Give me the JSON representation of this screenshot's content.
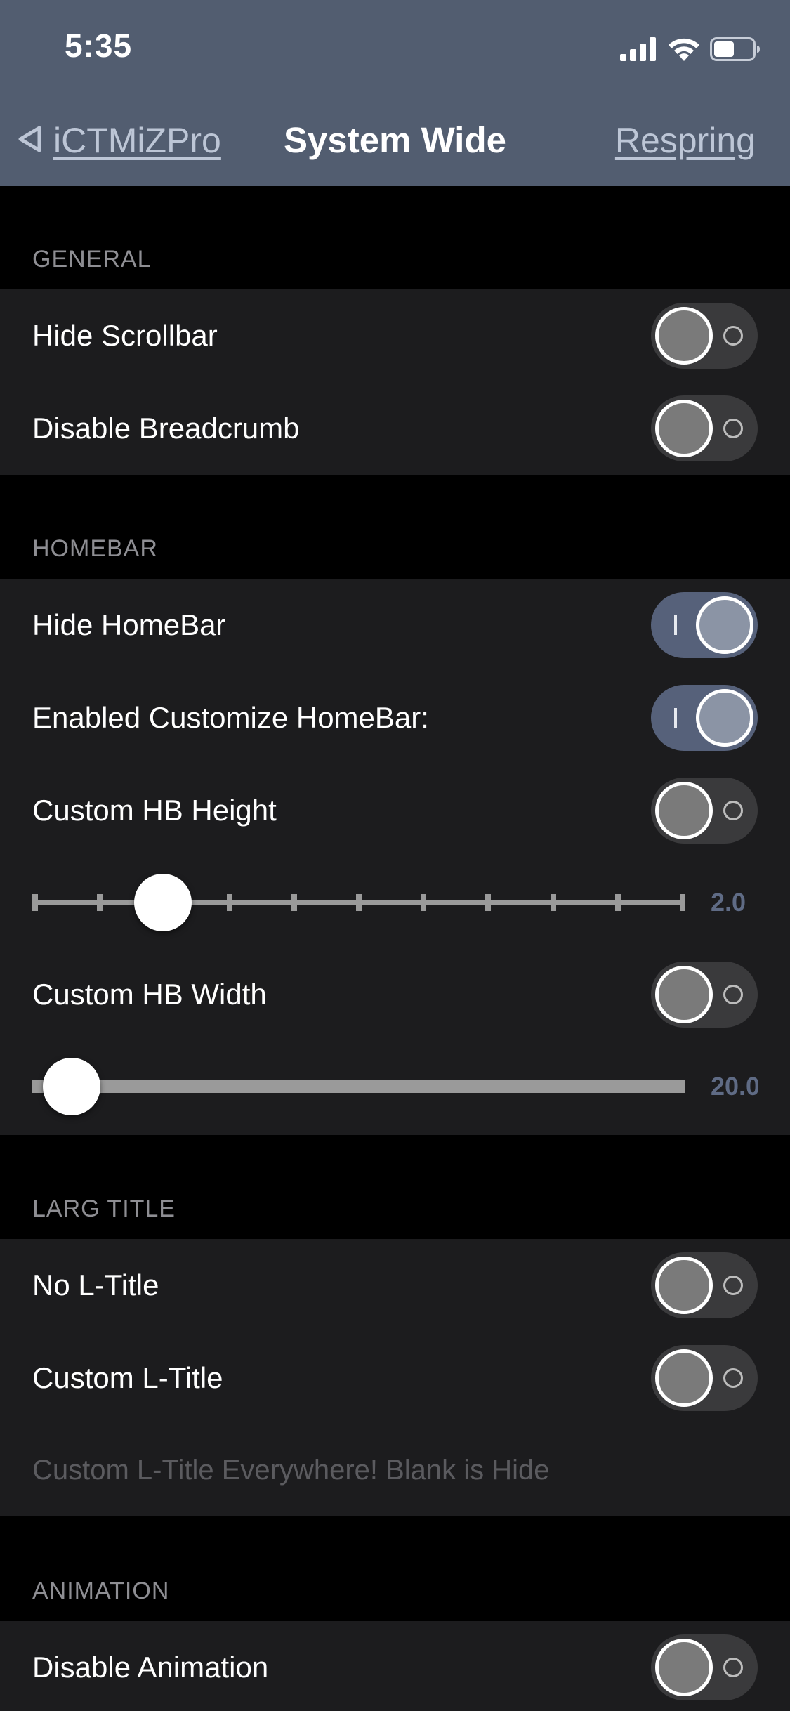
{
  "status_bar": {
    "time": "5:35",
    "icons": [
      "cellular-signal-icon",
      "wifi-icon",
      "battery-icon"
    ]
  },
  "nav": {
    "back_label": "iCTMiZPro",
    "title": "System Wide",
    "action_label": "Respring"
  },
  "colors": {
    "nav_background": "#525d70",
    "cell_background": "#1c1c1e",
    "switch_on": "#56617a",
    "switch_off": "#3a3a3c",
    "slider_value_text": "#5f6b85",
    "section_header_text": "#8e8e93"
  },
  "sections": {
    "general": {
      "header": "GENERAL",
      "rows": [
        {
          "label": "Hide Scrollbar",
          "enabled": false
        },
        {
          "label": "Disable Breadcrumb",
          "enabled": false
        }
      ]
    },
    "homebar": {
      "header": "HOMEBAR",
      "rows": [
        {
          "label": "Hide HomeBar",
          "enabled": true
        },
        {
          "label": "Enabled Customize HomeBar:",
          "enabled": true
        },
        {
          "label": "Custom HB Height",
          "enabled": false
        },
        {
          "label": "Custom HB Width",
          "enabled": false
        }
      ],
      "height_slider": {
        "value_text": "2.0",
        "fraction": 0.2,
        "tick_count": 11
      },
      "width_slider": {
        "value_text": "20.0",
        "fraction": 0.06
      }
    },
    "large_title": {
      "header": "LARG TITLE",
      "rows": [
        {
          "label": "No L-Title",
          "enabled": false
        },
        {
          "label": "Custom L-Title",
          "enabled": false
        }
      ],
      "text_field_placeholder": "Custom L-Title Everywhere! Blank is Hide"
    },
    "animation": {
      "header": "ANIMATION",
      "rows": [
        {
          "label": "Disable Animation",
          "enabled": false
        }
      ]
    }
  }
}
